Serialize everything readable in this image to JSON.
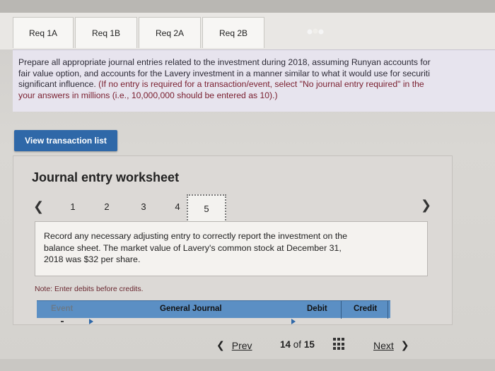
{
  "tabs": [
    {
      "label": "Req 1A"
    },
    {
      "label": "Req 1B"
    },
    {
      "label": "Req 2A"
    },
    {
      "label": "Req 2B"
    }
  ],
  "instructions": {
    "line1": "Prepare all appropriate journal entries related to the investment during 2018, assuming Runyan accounts for",
    "line2a": "fair value option, and accounts for the Lavery investment in a manner similar to what it would use for securiti",
    "line3a": "significant influence. ",
    "line3b": "(If no entry is required for a transaction/event, select \"No journal entry required\" in the",
    "line4": "your answers in millions (i.e., 10,000,000 should be entered as 10).)"
  },
  "view_button": {
    "label": "View transaction list"
  },
  "worksheet": {
    "title": "Journal entry worksheet",
    "steps": [
      "1",
      "2",
      "3",
      "4",
      "5"
    ],
    "record_text_1": "Record any necessary adjusting entry to correctly report the investment on the",
    "record_text_2": "balance sheet. The market value of Lavery's common stock at December 31,",
    "record_text_3": "2018 was $32 per share.",
    "note": "Note: Enter debits before credits."
  },
  "journal_table": {
    "headers": [
      "Event",
      "General Journal",
      "Debit",
      "Credit"
    ]
  },
  "pager": {
    "prev_label": "Prev",
    "current": "14",
    "of_label": "of",
    "total": "15",
    "next_label": "Next"
  },
  "colors": {
    "accent": "#2f68a8",
    "table_header": "#5b8fc4",
    "instruction_bg": "#e7e4ee"
  }
}
